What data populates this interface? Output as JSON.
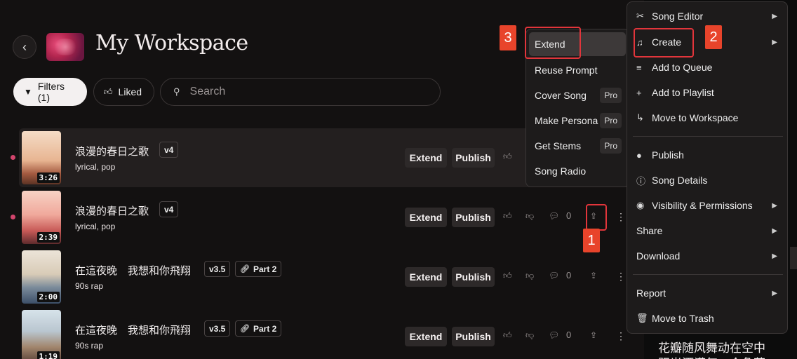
{
  "header": {
    "title": "My Workspace"
  },
  "filters": {
    "filters_label": "Filters (1)",
    "liked_label": "Liked",
    "search_placeholder": "Search"
  },
  "songs": [
    {
      "title": "浪漫的春日之歌",
      "version": "v4",
      "tags": "lyrical, pop",
      "duration": "3:26",
      "extend": "Extend",
      "publish": "Publish",
      "likes": "",
      "comments": ""
    },
    {
      "title": "浪漫的春日之歌",
      "version": "v4",
      "tags": "lyrical, pop",
      "duration": "2:39",
      "extend": "Extend",
      "publish": "Publish",
      "comments": "0"
    },
    {
      "title": "在這夜晚　我想和你飛翔",
      "version": "v3.5",
      "part": "Part 2",
      "tags": "90s rap",
      "duration": "2:00",
      "extend": "Extend",
      "publish": "Publish",
      "comments": "0"
    },
    {
      "title": "在這夜晚　我想和你飛翔",
      "version": "v3.5",
      "part": "Part 2",
      "tags": "90s rap",
      "duration": "1:19",
      "extend": "Extend",
      "publish": "Publish",
      "comments": "0"
    }
  ],
  "submenu": {
    "items": [
      "Extend",
      "Reuse Prompt",
      "Cover Song",
      "Make Persona",
      "Get Stems",
      "Song Radio"
    ],
    "pro": "Pro"
  },
  "context_menu": {
    "items": [
      "Song Editor",
      "Create",
      "Add to Queue",
      "Add to Playlist",
      "Move to Workspace",
      "Publish",
      "Song Details",
      "Visibility & Permissions",
      "Share",
      "Download",
      "Report",
      "Move to Trash"
    ]
  },
  "callouts": [
    "1",
    "2",
    "3"
  ],
  "right_panel": {
    "line1": "花瓣随风舞动在空中",
    "line2": "阳光洒满每一个角落"
  },
  "colors": {
    "accent_red": "#e2353b",
    "callout_bg": "#e8442b",
    "dot": "#d2456d"
  }
}
